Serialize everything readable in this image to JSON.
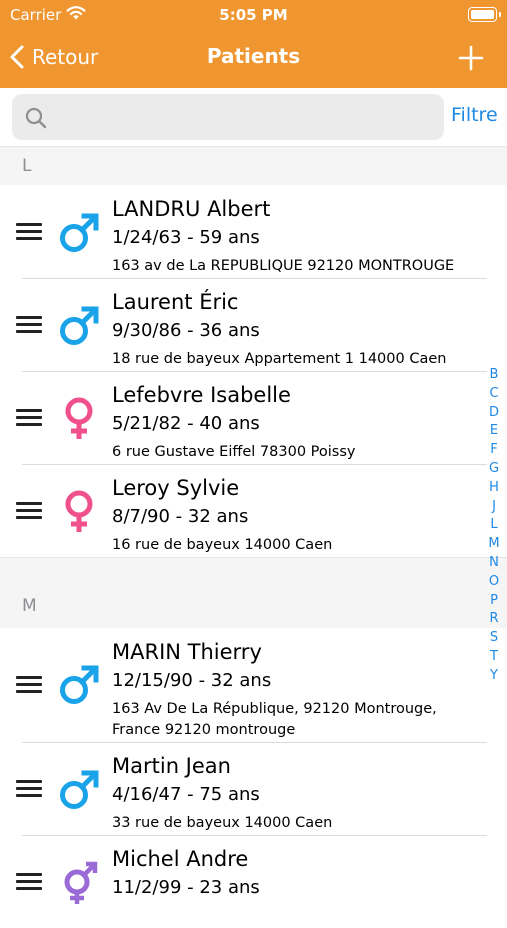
{
  "status_bar": {
    "carrier": "Carrier",
    "time": "5:05 PM"
  },
  "nav": {
    "back_label": "Retour",
    "title": "Patients",
    "add_icon": "plus-icon"
  },
  "search": {
    "value": "",
    "placeholder": "",
    "filter_label": "Filtre"
  },
  "colors": {
    "header": "#f09631",
    "male": "#1aa3e8",
    "female": "#f0508c",
    "unknown": "#9a6ad6",
    "link": "#1e88e5"
  },
  "sections": [
    {
      "letter": "L",
      "patients": [
        {
          "name": "LANDRU Albert",
          "dob": "1/24/63 - 59 ans",
          "address": "163 av de La REPUBLIQUE 92120 MONTROUGE",
          "gender": "male"
        },
        {
          "name": "Laurent Éric",
          "dob": "9/30/86 - 36 ans",
          "address": "18 rue de bayeux Appartement 1 14000 Caen",
          "gender": "male"
        },
        {
          "name": "Lefebvre Isabelle",
          "dob": "5/21/82 - 40 ans",
          "address": "6 rue Gustave Eiffel 78300 Poissy",
          "gender": "female"
        },
        {
          "name": "Leroy Sylvie",
          "dob": "8/7/90 - 32 ans",
          "address": "16 rue de bayeux 14000 Caen",
          "gender": "female"
        }
      ]
    },
    {
      "letter": "M",
      "patients": [
        {
          "name": "MARIN Thierry",
          "dob": "12/15/90 - 32 ans",
          "address": "163 Av De La République, 92120 Montrouge, France 92120 montrouge",
          "gender": "male"
        },
        {
          "name": "Martin Jean",
          "dob": "4/16/47 - 75 ans",
          "address": "33 rue de bayeux 14000 Caen",
          "gender": "male"
        },
        {
          "name": "Michel Andre",
          "dob": "11/2/99 - 23 ans",
          "address": "",
          "gender": "unknown"
        }
      ]
    }
  ],
  "index_letters": [
    "B",
    "C",
    "D",
    "E",
    "F",
    "G",
    "H",
    "J",
    "L",
    "M",
    "N",
    "O",
    "P",
    "R",
    "S",
    "T",
    "Y"
  ]
}
